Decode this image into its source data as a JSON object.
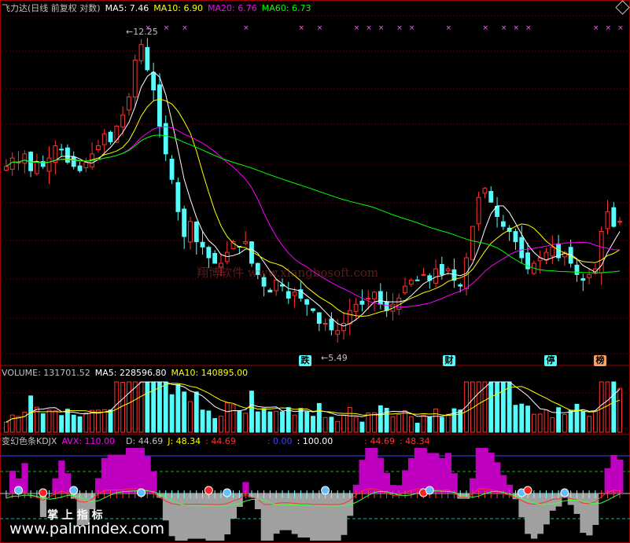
{
  "price_panel": {
    "title": "飞力达(日线 前复权 对数)",
    "ma5": "MA5: 7.46",
    "ma10": "MA10: 6.90",
    "ma20": "MA20: 6.76",
    "ma60": "MA60: 6.73",
    "high_label": "12.25",
    "low_label": "5.49",
    "signals": [
      "跌",
      "财",
      "停",
      "榜"
    ]
  },
  "volume_panel": {
    "volume": "VOLUME: 131701.52",
    "ma5": "MA5: 228596.80",
    "ma10": "MA10: 140895.00"
  },
  "kdj_panel": {
    "name": "变幻色条KDJX",
    "avx": "AVX: 110.00",
    "d": "D: 44.69",
    "j": "J: 48.34",
    "v1": ": 44.69",
    "v2": ": 0.00",
    "v3": ": 100.00",
    "v4": ": 44.69",
    "v5": ": 48.34"
  },
  "watermarks": {
    "site_cn": "翔博软件 www.xiangbosoft.com",
    "pm_cn": "掌 上 指 标",
    "pm_url": "www.palmindex.com"
  },
  "colors": {
    "up": "#ff3232",
    "down": "#54fcfc",
    "ma5": "#ffffff",
    "ma10": "#ffff00",
    "ma20": "#ff00ff",
    "ma60": "#00ff00",
    "kdj_fill_high": "#c000c0",
    "kdj_fill_low": "#a0a0a0"
  },
  "chart_data": {
    "type": "candlestick",
    "price_range": [
      5.49,
      12.25
    ],
    "closes": [
      8.6,
      8.8,
      8.7,
      8.9,
      8.5,
      8.7,
      8.6,
      8.8,
      9.1,
      9.0,
      8.7,
      8.6,
      8.5,
      8.7,
      8.9,
      9.1,
      9.4,
      9.2,
      9.6,
      9.9,
      10.4,
      11.5,
      12.0,
      11.2,
      10.6,
      9.6,
      8.9,
      8.3,
      7.6,
      7.1,
      7.4,
      7.0,
      6.9,
      6.7,
      6.6,
      6.6,
      6.8,
      7.0,
      6.9,
      7.0,
      6.6,
      6.4,
      6.2,
      6.1,
      6.3,
      6.2,
      6.0,
      6.1,
      6.0,
      5.9,
      5.8,
      5.6,
      5.6,
      5.5,
      5.49,
      5.6,
      5.8,
      5.9,
      5.9,
      6.0,
      6.1,
      5.9,
      5.8,
      5.9,
      6.0,
      6.2,
      6.3,
      6.3,
      6.4,
      6.3,
      6.5,
      6.4,
      6.5,
      6.3,
      6.2,
      6.7,
      7.3,
      7.9,
      8.1,
      7.8,
      7.5,
      7.3,
      7.2,
      7.0,
      6.7,
      6.5,
      6.6,
      6.7,
      6.8,
      6.9,
      6.7,
      6.8,
      6.6,
      6.4,
      6.3,
      6.4,
      6.5,
      7.2,
      7.6,
      7.3,
      7.4
    ]
  }
}
